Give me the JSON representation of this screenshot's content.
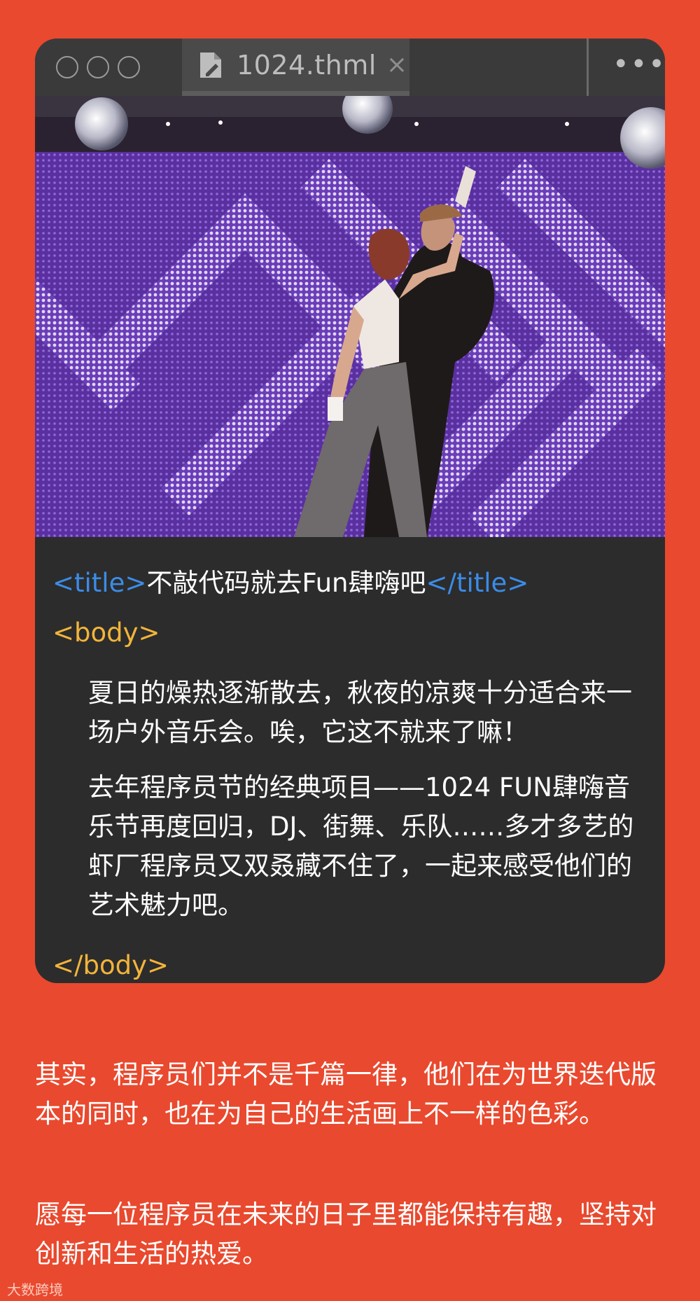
{
  "window": {
    "tab_label": "1024.thml",
    "tab_close": "×",
    "more_label": "•••"
  },
  "code": {
    "title_open": "<title>",
    "title_text": "不敲代码就去Fun肆嗨吧",
    "title_close": "</title>",
    "body_open": "<body>",
    "paragraph1": "夏日的燥热逐渐散去，秋夜的凉爽十分适合来一场户外音乐会。唉，它这不就来了嘛！",
    "paragraph2": "去年程序员节的经典项目——1024 FUN肆嗨音乐节再度回归，DJ、街舞、乐队……多才多艺的虾厂程序员又双叒藏不住了，一起来感受他们的艺术魅力吧。",
    "body_close": "</body>"
  },
  "article": {
    "paragraph1": "其实，程序员们并不是千篇一律，他们在为世界迭代版本的同时，也在为自己的生活画上不一样的色彩。",
    "paragraph2": "愿每一位程序员在未来的日子里都能保持有趣，坚持对创新和生活的热爱。"
  },
  "watermark": "大数跨境",
  "colors": {
    "background": "#e9492e",
    "card": "#2c2c2c",
    "tag_blue": "#3b8ce8",
    "tag_yellow": "#f3b43a"
  }
}
